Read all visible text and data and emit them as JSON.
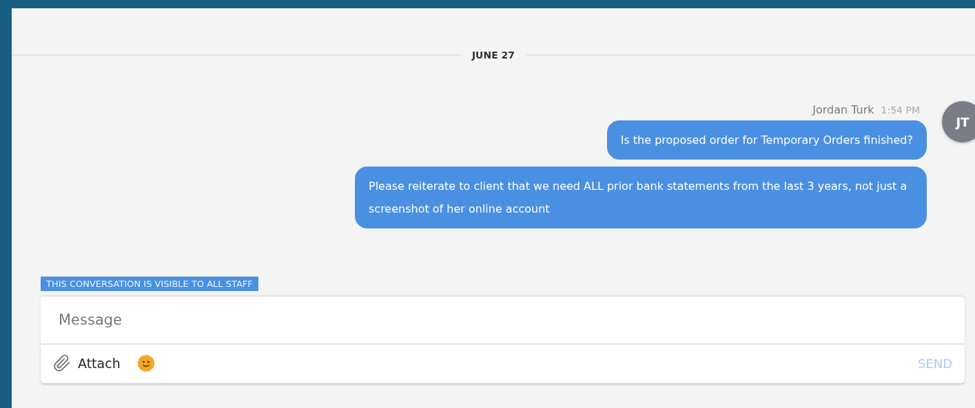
{
  "date_divider": "JUNE 27",
  "message_group": {
    "sender": "Jordan Turk",
    "time": "1:54 PM",
    "avatar_initials": "JT",
    "messages": [
      "Is the proposed order for Temporary Orders finished?",
      "Please reiterate to client that we need ALL prior bank statements from the last 3 years, not just a screenshot of her online account"
    ]
  },
  "visibility_notice": "THIS CONVERSATION IS VISIBLE TO ALL STAFF",
  "composer": {
    "placeholder": "Message",
    "attach_label": "Attach",
    "send": {
      "label": "SEND",
      "disabled": true
    }
  }
}
